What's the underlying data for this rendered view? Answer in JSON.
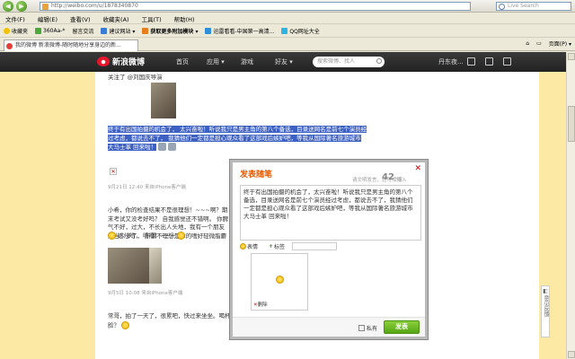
{
  "browser": {
    "url": "http://weibo.com/u/1878340870",
    "search_placeholder": "Live Search",
    "menu": [
      "文件(F)",
      "编辑(E)",
      "查看(V)",
      "收藏夹(A)",
      "工具(T)",
      "帮助(H)"
    ],
    "favorites": [
      "收藏夹",
      "360Aa-*",
      "留言交流",
      "建议网站 ▾",
      "获取更多附加模块 ▾",
      "迅雷看看-中国第一高清...",
      "QQ网址大全"
    ],
    "tab_title": "我的微博 新浪微博-随时随地分享身边的新...",
    "tab_tools": [
      "页面(P) ▾"
    ]
  },
  "weibo_nav": {
    "logo": "新浪微博",
    "links": [
      "首页",
      "应用 ▾",
      "游戏",
      "好友 ▾"
    ],
    "search_placeholder": "搜索微博、找人",
    "user": "丹东夜..."
  },
  "feed": {
    "line0": "关注了 @刘国庆导演",
    "post1": "终于有出国拍摄的机会了，  太兴奋啦！听说我只是男主角的第八个备选，目录送网名是前七个演员经过考虑，都说去不了，  我猜他们一定都是担心观众看了这部戏后嫉妒吧，等我从国际著名旅游城市 大马士革 回来啦！",
    "meta1": "9月21日 12:40  来自iPhone客户端",
    "post2": "小希，你的检查结果不是很理想！~~~啊？期末考试又没考好吗？ 自我感觉还不错啊。 你脾气不好，过大，不长出人头地，我有一个朋友想当少多了，  所谓不理想是你的嗜好轻微脂麝醇超标 我的天",
    "post2b": "这儿哟，  嘻嘻！~~~",
    "meta2": "9月5日 10:08  来自iPhone客户端",
    "post3": "常哥，拍了一天了，很累吧，快过来坐坐。喝杯茶，",
    "post3b": "脸？",
    "feedback": "意见反馈"
  },
  "dialog": {
    "title": "发表随笔",
    "close": "✕",
    "hint": "请文明发言，还可以输入",
    "count": "42",
    "count_suffix": "个字",
    "text": "终于有出国拍摄的机会了，太兴奋啦！听说我只是男主角的第八个备选，目录送网名是前七个演员经过考虑，都说去不了，我猜他们一定都是担心观众看了这部戏后嫉妒吧，等我从国际著名旅游城市 大马士革 回来啦！",
    "tool_emoticon": "表情",
    "tool_tag": "标签",
    "delete": "删除",
    "sync": "私有",
    "send": "发表"
  }
}
